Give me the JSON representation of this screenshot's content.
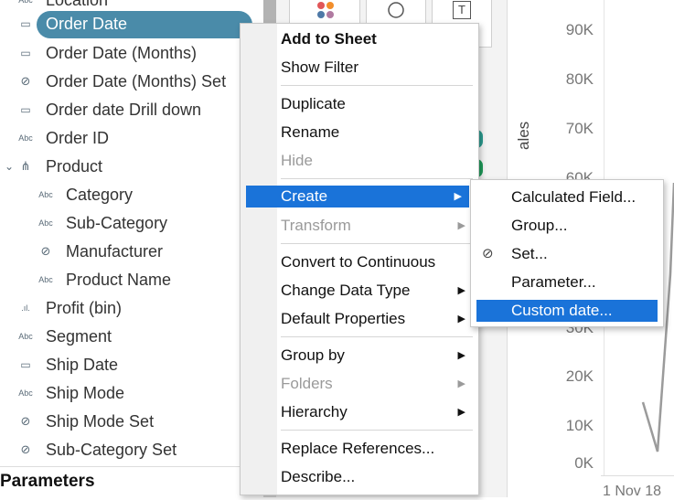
{
  "data_pane": {
    "fields": [
      {
        "label": "Location",
        "icon": "abc-icon"
      },
      {
        "label": "Order Date",
        "icon": "date-icon",
        "selected": true
      },
      {
        "label": "Order Date (Months)",
        "icon": "date-custom-icon"
      },
      {
        "label": "Order Date (Months) Set",
        "icon": "set-icon"
      },
      {
        "label": "Order date Drill down",
        "icon": "date-hierarchy-icon"
      },
      {
        "label": "Order ID",
        "icon": "abc-icon"
      },
      {
        "label": "Product",
        "icon": "hierarchy-icon",
        "expanded": true
      },
      {
        "label": "Category",
        "icon": "abc-icon"
      },
      {
        "label": "Sub-Category",
        "icon": "abc-icon"
      },
      {
        "label": "Manufacturer",
        "icon": "group-clip-icon"
      },
      {
        "label": "Product Name",
        "icon": "abc-icon"
      },
      {
        "label": "Profit (bin)",
        "icon": "bin-icon"
      },
      {
        "label": "Segment",
        "icon": "abc-icon"
      },
      {
        "label": "Ship Date",
        "icon": "date-icon"
      },
      {
        "label": "Ship Mode",
        "icon": "abc-icon"
      },
      {
        "label": "Ship Mode Set",
        "icon": "set-icon"
      },
      {
        "label": "Sub-Category Set",
        "icon": "set-icon"
      }
    ],
    "parameters_header": "Parameters"
  },
  "icon_text": {
    "abc": "Abc",
    "date": "▭",
    "set": "⊘",
    "hierarchy": "⋔",
    "bin": ".ıl.",
    "clip": "⊘",
    "expand": "⌄"
  },
  "shelf": {
    "text_icon": "T"
  },
  "chart": {
    "y_ticks": [
      "90K",
      "80K",
      "70K",
      "60K",
      "30K",
      "20K",
      "10K",
      "0K"
    ],
    "y_axis_label": "ales",
    "x_tick": "1 Nov 18"
  },
  "context_menu": {
    "items": [
      {
        "label": "Add to Sheet",
        "bold": true
      },
      {
        "label": "Show Filter"
      },
      {
        "label": "Duplicate"
      },
      {
        "label": "Rename"
      },
      {
        "label": "Hide",
        "disabled": true
      },
      {
        "label": "Create",
        "submenu": true,
        "highlighted": true
      },
      {
        "label": "Transform",
        "submenu": true,
        "disabled": true
      },
      {
        "label": "Convert to Continuous"
      },
      {
        "label": "Change Data Type",
        "submenu": true
      },
      {
        "label": "Default Properties",
        "submenu": true
      },
      {
        "label": "Group by",
        "submenu": true
      },
      {
        "label": "Folders",
        "submenu": true,
        "disabled": true
      },
      {
        "label": "Hierarchy",
        "submenu": true
      },
      {
        "label": "Replace References..."
      },
      {
        "label": "Describe..."
      }
    ]
  },
  "create_submenu": {
    "items": [
      {
        "label": "Calculated Field..."
      },
      {
        "label": "Group..."
      },
      {
        "label": "Set...",
        "icon": "set-icon"
      },
      {
        "label": "Parameter..."
      },
      {
        "label": "Custom date...",
        "highlighted": true
      }
    ]
  },
  "colors": {
    "selected_pill": "#4a8ba9",
    "highlight": "#1a73d9",
    "dot_teal": "#2b9b8f",
    "dot_green": "#1f9b5a"
  }
}
